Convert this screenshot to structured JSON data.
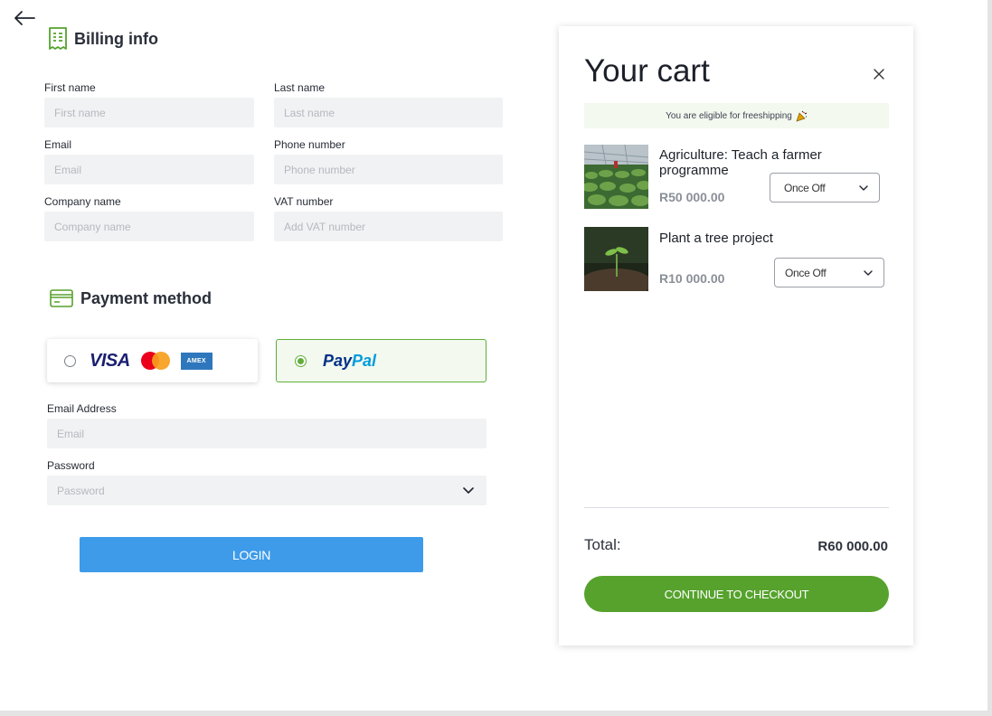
{
  "nav": {
    "back_icon": "arrow-left-icon"
  },
  "billing": {
    "title": "Billing info",
    "icon": "receipt-icon",
    "fields": {
      "first_name": {
        "label": "First name",
        "placeholder": "First name",
        "value": ""
      },
      "last_name": {
        "label": "Last name",
        "placeholder": "Last name",
        "value": ""
      },
      "email": {
        "label": "Email",
        "placeholder": "Email",
        "value": ""
      },
      "phone": {
        "label": "Phone number",
        "placeholder": "Phone number",
        "value": ""
      },
      "company": {
        "label": "Company name",
        "placeholder": "Company name",
        "value": ""
      },
      "vat": {
        "label": "VAT number",
        "placeholder": "Add VAT number",
        "value": ""
      }
    }
  },
  "payment": {
    "title": "Payment method",
    "icon": "credit-card-icon",
    "options": [
      {
        "id": "card",
        "selected": false,
        "brands": [
          "VISA",
          "Mastercard",
          "AMEX"
        ],
        "visa_text": "VISA",
        "amex_text": "AMEX"
      },
      {
        "id": "paypal",
        "selected": true,
        "brand_part1": "Pay",
        "brand_part2": "Pal"
      }
    ],
    "email": {
      "label": "Email Address",
      "placeholder": "Email",
      "value": ""
    },
    "password": {
      "label": "Password",
      "placeholder": "Password",
      "value": ""
    },
    "login_label": "LOGIN"
  },
  "cart": {
    "title": "Your cart",
    "shipping_banner": "You are eligible for freeshipping",
    "items": [
      {
        "name": "Agriculture: Teach a farmer programme",
        "price": "R50 000.00",
        "frequency": "Once Off"
      },
      {
        "name": "Plant a tree project",
        "price": "R10 000.00",
        "frequency": "Once Off"
      }
    ],
    "total_label": "Total:",
    "total_value": "R60 000.00",
    "checkout_label": "CONTINUE TO CHECKOUT"
  },
  "colors": {
    "accent_green": "#56a22d",
    "login_blue": "#3d9be9",
    "input_bg": "#f1f2f4",
    "banner_bg": "#f3f9ef"
  }
}
